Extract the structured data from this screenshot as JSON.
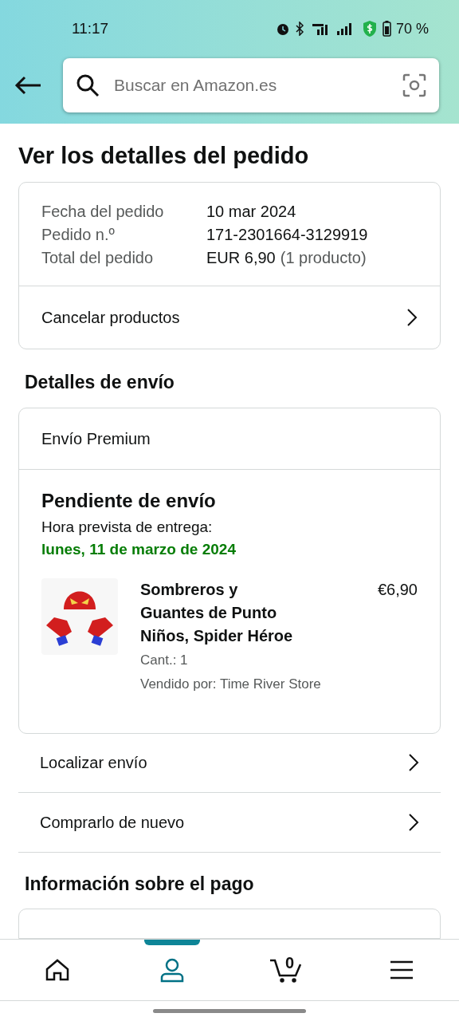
{
  "status_bar": {
    "time": "11:17",
    "battery": "70 %"
  },
  "search": {
    "placeholder": "Buscar en Amazon.es"
  },
  "page_title": "Ver los detalles del pedido",
  "order_summary": {
    "rows": [
      {
        "label": "Fecha del pedido",
        "value": "10 mar 2024"
      },
      {
        "label": "Pedido n.º",
        "value": "171-2301664-3129919"
      },
      {
        "label": "Total del pedido",
        "value": "EUR 6,90",
        "note": "(1 producto)"
      }
    ],
    "action": "Cancelar productos"
  },
  "shipping": {
    "heading": "Detalles de envío",
    "method": "Envío Premium",
    "status": "Pendiente de envío",
    "eta_label": "Hora prevista de entrega:",
    "eta_date": "lunes, 11 de marzo de 2024",
    "item": {
      "title": "Sombreros y Guantes de Punto Niños, Spider Héroe",
      "price": "€6,90",
      "quantity": "Cant.: 1",
      "seller": "Vendido por: Time River Store"
    }
  },
  "actions": [
    "Localizar envío",
    "Comprarlo de nuevo"
  ],
  "payment": {
    "heading": "Información sobre el pago"
  },
  "bottom_nav": [
    {
      "kind": "home",
      "selected": false
    },
    {
      "kind": "account",
      "selected": true
    },
    {
      "kind": "cart",
      "selected": false,
      "count": "0"
    },
    {
      "kind": "menu",
      "selected": false
    }
  ]
}
